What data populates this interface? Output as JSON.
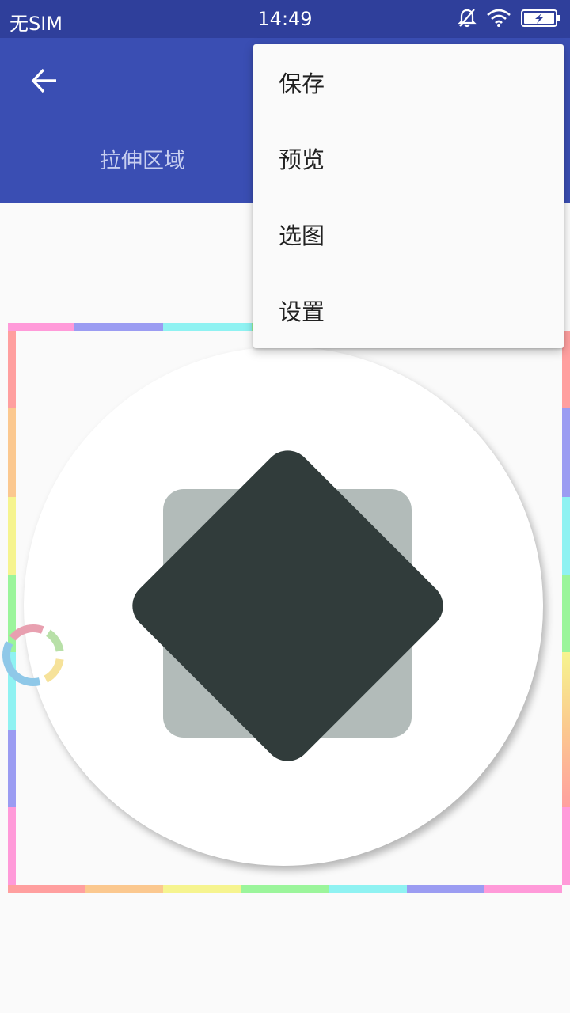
{
  "status_bar": {
    "carrier": "无SIM",
    "time": "14:49",
    "icons": [
      "bell-off-icon",
      "wifi-icon",
      "battery-charging-icon"
    ]
  },
  "app_bar": {
    "back_icon": "arrow-left-icon",
    "tab_left": "拉伸区域"
  },
  "menu": {
    "items": [
      {
        "label": "保存"
      },
      {
        "label": "预览"
      },
      {
        "label": "选图"
      },
      {
        "label": "设置"
      }
    ]
  },
  "colors": {
    "status_bar": "#2f3f9b",
    "app_bar": "#3a4eb3",
    "background": "#fafafa",
    "diamond": "#313c3b",
    "square": "#b2bbb9"
  }
}
